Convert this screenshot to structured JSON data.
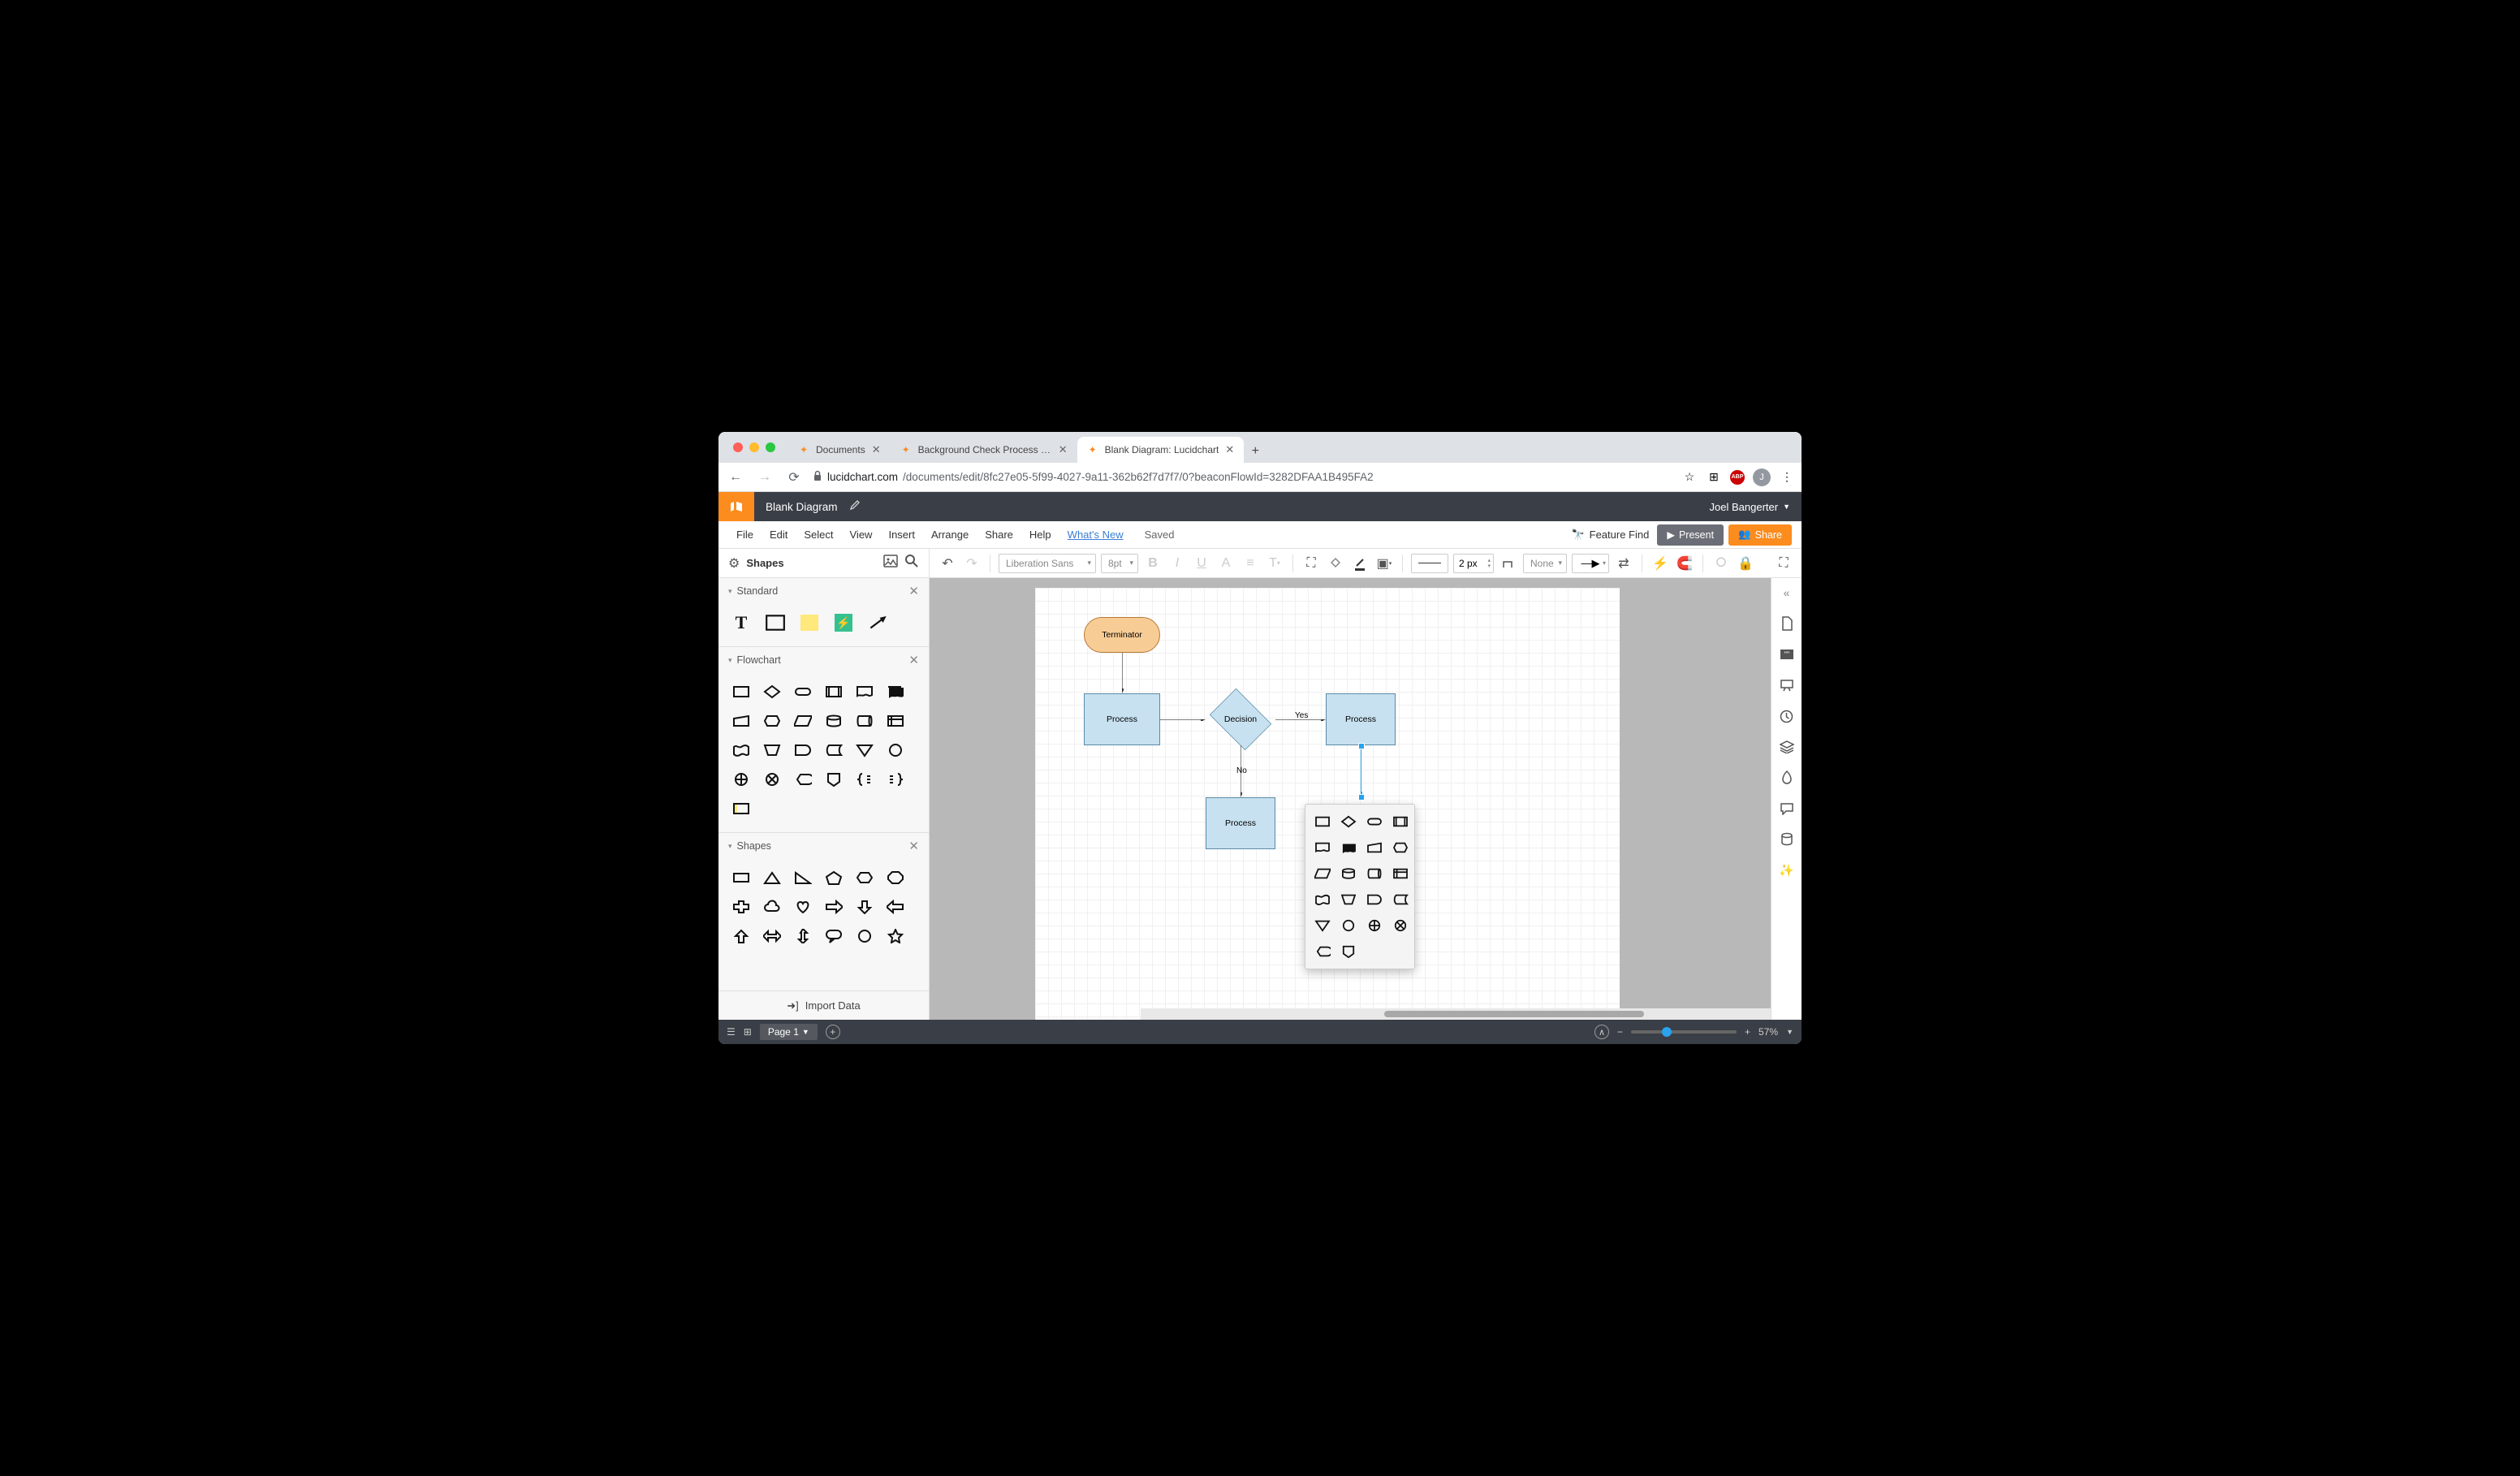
{
  "browser": {
    "tabs": [
      {
        "title": "Documents",
        "active": false
      },
      {
        "title": "Background Check Process Flo",
        "active": false
      },
      {
        "title": "Blank Diagram: Lucidchart",
        "active": true
      }
    ],
    "url_domain": "lucidchart.com",
    "url_path": "/documents/edit/8fc27e05-5f99-4027-9a11-362b62f7d7f7/0?beaconFlowId=3282DFAA1B495FA2",
    "avatar_initial": "J"
  },
  "app": {
    "doc_title": "Blank Diagram",
    "user": "Joel Bangerter"
  },
  "menu": {
    "items": [
      "File",
      "Edit",
      "Select",
      "View",
      "Insert",
      "Arrange",
      "Share",
      "Help"
    ],
    "whatsnew": "What's New",
    "saved": "Saved",
    "feature_find": "Feature Find",
    "present": "Present",
    "share": "Share"
  },
  "toolbar": {
    "shapes_label": "Shapes",
    "font": "Liberation Sans",
    "fontsize": "8pt",
    "linewidth": "2 px",
    "fill": "None"
  },
  "leftpanel": {
    "sections": {
      "standard": "Standard",
      "flowchart": "Flowchart",
      "shapes": "Shapes"
    },
    "import": "Import Data"
  },
  "diagram": {
    "terminator": "Terminator",
    "process1": "Process",
    "decision": "Decision",
    "process2": "Process",
    "process3": "Process",
    "yes": "Yes",
    "no": "No"
  },
  "footer": {
    "page": "Page 1",
    "zoom": "57%"
  }
}
